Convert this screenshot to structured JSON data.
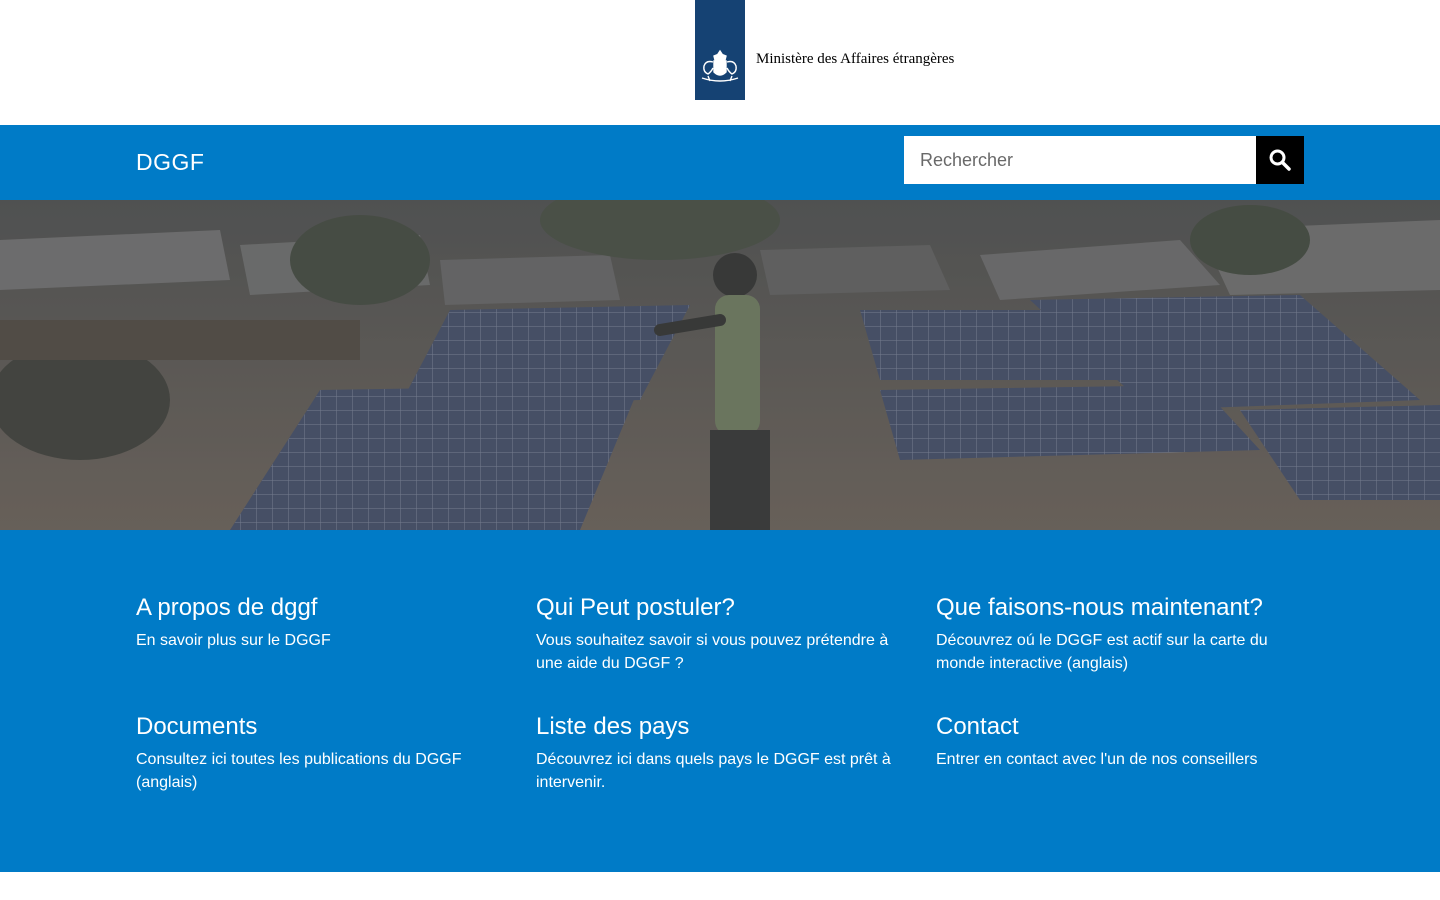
{
  "header": {
    "ministry_name": "Ministère des Affaires étrangères",
    "logo_icon": "dutch-coat-of-arms-icon",
    "logo_color": "#154273"
  },
  "topbar": {
    "site_title": "DGGF",
    "search_placeholder": "Rechercher",
    "search_icon": "search-icon",
    "bar_color": "#007bc7"
  },
  "hero": {
    "image_description_icon": "solar-panels-photo"
  },
  "tiles": [
    {
      "title": "A propos de dggf",
      "description": "En savoir plus sur le DGGF"
    },
    {
      "title": "Qui Peut postuler?",
      "description": "Vous souhaitez savoir si vous pouvez prétendre à une aide du DGGF ?"
    },
    {
      "title": "Que faisons-nous maintenant?",
      "description": "Découvrez oú le DGGF est actif sur la carte du monde interactive (anglais)"
    },
    {
      "title": "Documents",
      "description": "Consultez ici toutes les publications du DGGF (anglais)"
    },
    {
      "title": "Liste des pays",
      "description": "Découvrez ici dans quels pays le DGGF est prêt à intervenir."
    },
    {
      "title": "Contact",
      "description": "Entrer en contact avec l'un de nos conseillers"
    }
  ]
}
